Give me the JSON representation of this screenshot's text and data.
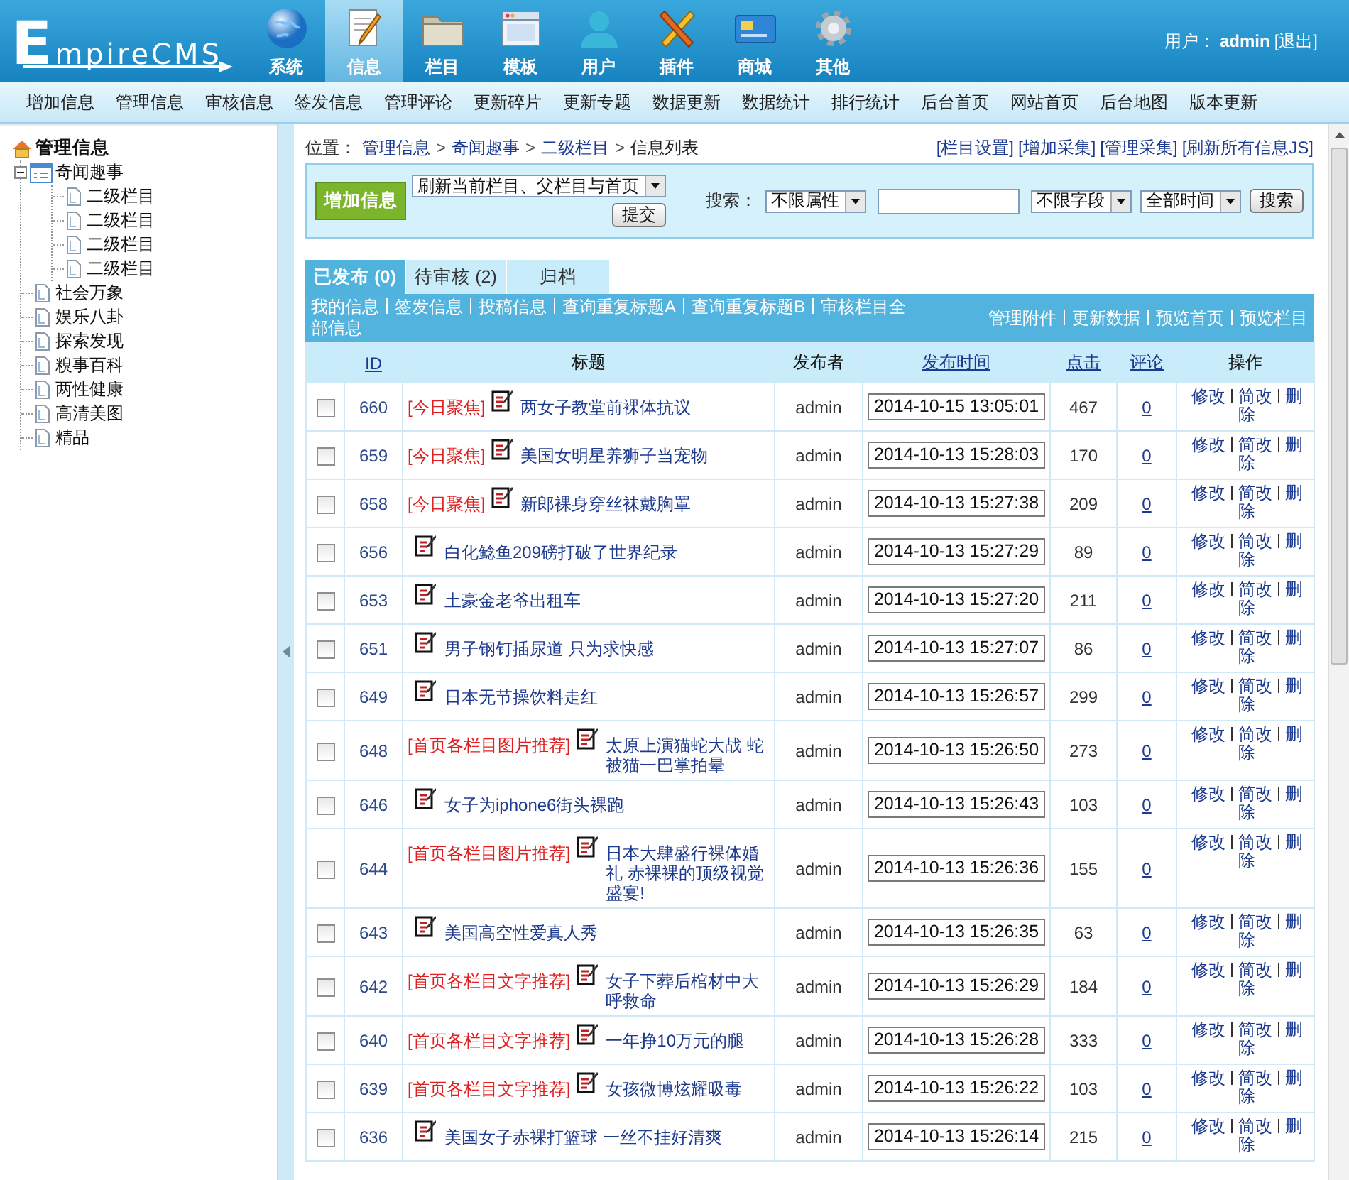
{
  "header": {
    "logo": "EmpireCMS",
    "nav": [
      {
        "label": "系统",
        "selected": false
      },
      {
        "label": "信息",
        "selected": true
      },
      {
        "label": "栏目",
        "selected": false
      },
      {
        "label": "模板",
        "selected": false
      },
      {
        "label": "用户",
        "selected": false
      },
      {
        "label": "插件",
        "selected": false
      },
      {
        "label": "商城",
        "selected": false
      },
      {
        "label": "其他",
        "selected": false
      }
    ],
    "user": {
      "label": "用户：",
      "name": "admin",
      "logout": "[退出]"
    }
  },
  "menu": [
    "增加信息",
    "管理信息",
    "审核信息",
    "签发信息",
    "管理评论",
    "更新碎片",
    "更新专题",
    "数据更新",
    "数据统计",
    "排行统计",
    "后台首页",
    "网站首页",
    "后台地图",
    "版本更新"
  ],
  "sidebar": {
    "root": "管理信息",
    "items": [
      {
        "label": "奇闻趣事",
        "expanded": true,
        "children": [
          {
            "label": "二级栏目"
          },
          {
            "label": "二级栏目"
          },
          {
            "label": "二级栏目"
          },
          {
            "label": "二级栏目"
          }
        ]
      },
      {
        "label": "社会万象"
      },
      {
        "label": "娱乐八卦"
      },
      {
        "label": "探索发现"
      },
      {
        "label": "糗事百科"
      },
      {
        "label": "两性健康"
      },
      {
        "label": "高清美图"
      },
      {
        "label": "精品"
      }
    ]
  },
  "breadcrumb": {
    "label": "位置：",
    "items": [
      {
        "text": "管理信息",
        "kind": "link"
      },
      {
        "text": ">",
        "kind": "sep"
      },
      {
        "text": "奇闻趣事",
        "kind": "link"
      },
      {
        "text": ">",
        "kind": "sep"
      },
      {
        "text": "二级栏目",
        "kind": "link"
      },
      {
        "text": ">",
        "kind": "sep"
      },
      {
        "text": "信息列表",
        "kind": "current"
      }
    ]
  },
  "top_links": [
    "[栏目设置]",
    "[增加采集]",
    "[管理采集]",
    "[刷新所有信息JS]"
  ],
  "toolbar": {
    "add_button": "增加信息",
    "refresh_select": "刷新当前栏目、父栏目与首页",
    "submit_button": "提交",
    "search_label": "搜索：",
    "attribute_select": "不限属性",
    "field_select": "不限字段",
    "time_select": "全部时间",
    "search_button": "搜索"
  },
  "tabs": [
    {
      "label": "已发布 (0)",
      "selected": true
    },
    {
      "label": "待审核 (2)",
      "selected": false
    },
    {
      "label": "归档",
      "selected": false
    }
  ],
  "links_left": [
    "我的信息",
    "签发信息",
    "投稿信息",
    "查询重复标题A",
    "查询重复标题B",
    "审核栏目全部信息"
  ],
  "links_right": [
    "管理附件",
    "更新数据",
    "预览首页",
    "预览栏目"
  ],
  "table": {
    "columns": [
      {
        "label": "ID",
        "link": true
      },
      {
        "label": "标题",
        "link": false
      },
      {
        "label": "发布者",
        "link": false
      },
      {
        "label": "发布时间",
        "link": true
      },
      {
        "label": "点击",
        "link": true
      },
      {
        "label": "评论",
        "link": true
      },
      {
        "label": "操作",
        "link": false
      }
    ],
    "rows": [
      {
        "checked": false,
        "id": "660",
        "tag": "[今日聚焦]",
        "title": "两女子教堂前裸体抗议",
        "publisher": "admin",
        "time": "2014-10-15 13:05:01",
        "clicks": "467",
        "comments": "0",
        "actions": [
          "修改",
          "简改",
          "删除"
        ]
      },
      {
        "checked": false,
        "id": "659",
        "tag": "[今日聚焦]",
        "title": "美国女明星养狮子当宠物",
        "publisher": "admin",
        "time": "2014-10-13 15:28:03",
        "clicks": "170",
        "comments": "0",
        "actions": [
          "修改",
          "简改",
          "删除"
        ]
      },
      {
        "checked": false,
        "id": "658",
        "tag": "[今日聚焦]",
        "title": "新郎裸身穿丝袜戴胸罩",
        "publisher": "admin",
        "time": "2014-10-13 15:27:38",
        "clicks": "209",
        "comments": "0",
        "actions": [
          "修改",
          "简改",
          "删除"
        ]
      },
      {
        "checked": false,
        "id": "656",
        "title": "白化鲶鱼209磅打破了世界纪录",
        "publisher": "admin",
        "time": "2014-10-13 15:27:29",
        "clicks": "89",
        "comments": "0",
        "actions": [
          "修改",
          "简改",
          "删除"
        ]
      },
      {
        "checked": false,
        "id": "653",
        "title": "土豪金老爷出租车",
        "publisher": "admin",
        "time": "2014-10-13 15:27:20",
        "clicks": "211",
        "comments": "0",
        "actions": [
          "修改",
          "简改",
          "删除"
        ]
      },
      {
        "checked": false,
        "id": "651",
        "title": "男子钢钉插尿道 只为求快感",
        "publisher": "admin",
        "time": "2014-10-13 15:27:07",
        "clicks": "86",
        "comments": "0",
        "actions": [
          "修改",
          "简改",
          "删除"
        ]
      },
      {
        "checked": false,
        "id": "649",
        "title": "日本无节操饮料走红",
        "publisher": "admin",
        "time": "2014-10-13 15:26:57",
        "clicks": "299",
        "comments": "0",
        "actions": [
          "修改",
          "简改",
          "删除"
        ]
      },
      {
        "checked": false,
        "id": "648",
        "tag": "[首页各栏目图片推荐]",
        "title": "太原上演猫蛇大战 蛇被猫一巴掌拍晕",
        "publisher": "admin",
        "time": "2014-10-13 15:26:50",
        "clicks": "273",
        "comments": "0",
        "actions": [
          "修改",
          "简改",
          "删除"
        ]
      },
      {
        "checked": false,
        "id": "646",
        "title": "女子为iphone6街头裸跑",
        "publisher": "admin",
        "time": "2014-10-13 15:26:43",
        "clicks": "103",
        "comments": "0",
        "actions": [
          "修改",
          "简改",
          "删除"
        ]
      },
      {
        "checked": false,
        "id": "644",
        "tag": "[首页各栏目图片推荐]",
        "title": "日本大肆盛行裸体婚礼 赤裸裸的顶级视觉盛宴!",
        "publisher": "admin",
        "time": "2014-10-13 15:26:36",
        "clicks": "155",
        "comments": "0",
        "actions": [
          "修改",
          "简改",
          "删除"
        ]
      },
      {
        "checked": false,
        "id": "643",
        "title": "美国高空性爱真人秀",
        "publisher": "admin",
        "time": "2014-10-13 15:26:35",
        "clicks": "63",
        "comments": "0",
        "actions": [
          "修改",
          "简改",
          "删除"
        ]
      },
      {
        "checked": false,
        "id": "642",
        "tag": "[首页各栏目文字推荐]",
        "title": "女子下葬后棺材中大呼救命",
        "publisher": "admin",
        "time": "2014-10-13 15:26:29",
        "clicks": "184",
        "comments": "0",
        "actions": [
          "修改",
          "简改",
          "删除"
        ]
      },
      {
        "checked": false,
        "id": "640",
        "tag": "[首页各栏目文字推荐]",
        "title": "一年挣10万元的腿",
        "publisher": "admin",
        "time": "2014-10-13 15:26:28",
        "clicks": "333",
        "comments": "0",
        "actions": [
          "修改",
          "简改",
          "删除"
        ]
      },
      {
        "checked": false,
        "id": "639",
        "tag": "[首页各栏目文字推荐]",
        "title": "女孩微博炫耀吸毒",
        "publisher": "admin",
        "time": "2014-10-13 15:26:22",
        "clicks": "103",
        "comments": "0",
        "actions": [
          "修改",
          "简改",
          "删除"
        ]
      },
      {
        "checked": false,
        "id": "636",
        "title": "美国女子赤裸打篮球 一丝不挂好清爽",
        "publisher": "admin",
        "time": "2014-10-13 15:26:14",
        "clicks": "215",
        "comments": "0",
        "actions": [
          "修改",
          "简改",
          "删除"
        ]
      }
    ]
  }
}
